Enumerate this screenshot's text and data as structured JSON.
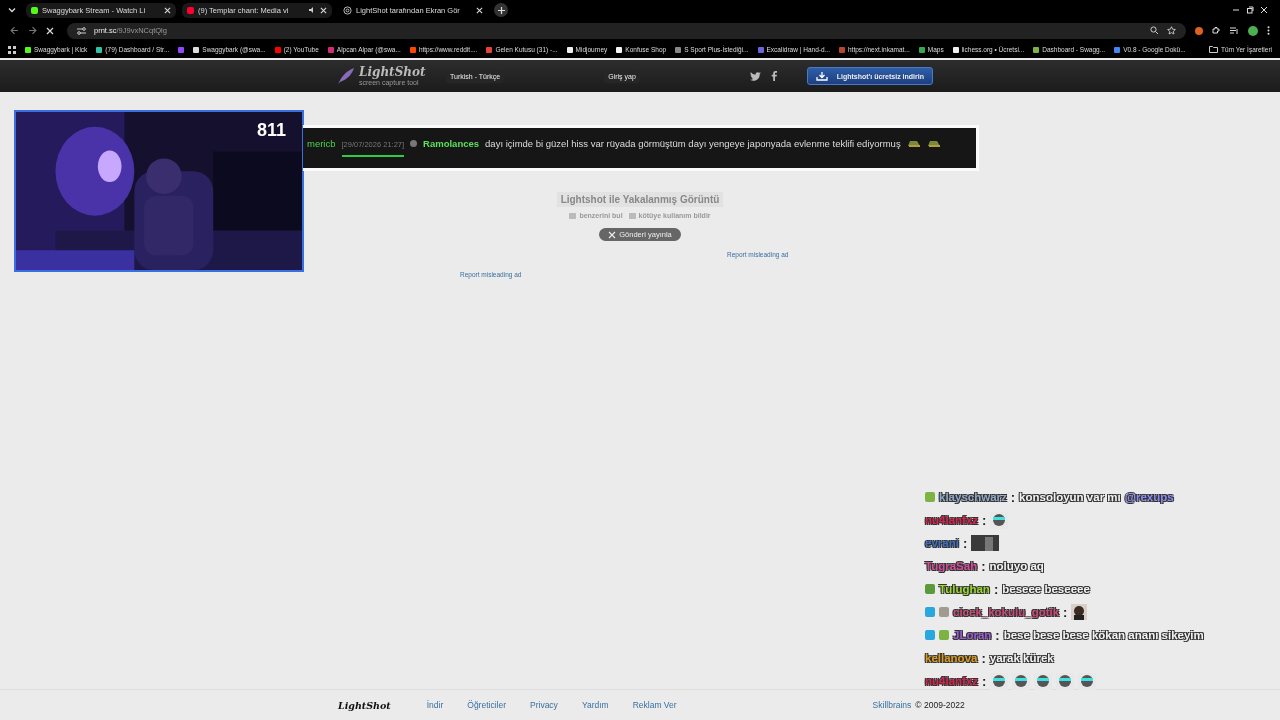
{
  "browser": {
    "tabs": [
      {
        "title": "Swaggybark Stream - Watch Li",
        "kind": "kick",
        "audio": false,
        "selected": false
      },
      {
        "title": "(9) Templar chant: Media vi",
        "kind": "youtube",
        "audio": true,
        "selected": false
      },
      {
        "title": "LightShot tarafından Ekran Gör",
        "kind": "lightshot",
        "audio": false,
        "selected": true
      }
    ],
    "address": {
      "host": "prnt.sc",
      "path": "/9J9vxNCqtQlg"
    },
    "bookmarks": [
      {
        "title": "Swaggybark | Kick",
        "color": "#53fc18"
      },
      {
        "title": "(79) Dashboard / Str...",
        "color": "#2ec4a6"
      },
      {
        "color": "#9146ff"
      },
      {
        "title": "Swaggybark (@swa...",
        "color": "#dddddd"
      },
      {
        "title": "(2) YouTube",
        "color": "#ff0000"
      },
      {
        "title": "Alpcan Alpar (@swa...",
        "color": "#d62976"
      },
      {
        "title": "https://www.reddit....",
        "color": "#ff4500"
      },
      {
        "title": "Gelen Kutusu (31) -...",
        "color": "#ea4335"
      },
      {
        "title": "Midjourney",
        "color": "#eeeeee"
      },
      {
        "title": "Konfuse Shop",
        "color": "#f5f5f5"
      },
      {
        "title": "S Sport Plus-İstediği...",
        "color": "#888888"
      },
      {
        "title": "Excalidraw | Hand-d...",
        "color": "#6965db"
      },
      {
        "title": "https://next.inkamat...",
        "color": "#b5462b"
      },
      {
        "title": "Maps",
        "color": "#34a853"
      },
      {
        "title": "lichess.org • Ücretsi...",
        "color": "#f0f0f0"
      },
      {
        "title": "Dashboard - Swagg...",
        "color": "#7cb342"
      },
      {
        "title": "V0.8 - Google Dokü...",
        "color": "#4285f4"
      }
    ],
    "all_bookmarks": "Tüm Yer İşaretleri"
  },
  "site_header": {
    "logo": "LightShot",
    "tagline": "screen capture tool",
    "language": "Turkish - Türkçe",
    "login": "Giriş yap",
    "download": "Lightshot'ı ücretsiz indirin"
  },
  "webcam": {
    "kind": "picture",
    "viewer_count": "811"
  },
  "highlight": {
    "user": "mericb",
    "timestamp": "[29/07/2026 21:27]",
    "author": "Ramolances",
    "message": "dayı içimde bi güzel hiss var rüyada görmüştüm dayı yengeye japonyada evlenme teklifi ediyormuş",
    "emotes": [
      {
        "kind": "car"
      },
      {
        "kind": "car"
      }
    ]
  },
  "content": {
    "title": "Lightshot ile Yakalanmış Görüntü",
    "actions": [
      "benzerini bul",
      "kötüye kullanım bildir"
    ],
    "share": "Gönderi yayınla",
    "ads": [
      "Report misleading ad",
      "Report misleading ad"
    ]
  },
  "chat": [
    {
      "user": "klayschwarz",
      "color": "#8fa8c8",
      "separator": ":",
      "badges": [
        {
          "kind": "paw"
        }
      ],
      "text": "konsoloyun var mı",
      "mention": "@rexups"
    },
    {
      "user": "nu4lanfxz",
      "color": "#d6244e",
      "separator": ":",
      "emotes": [
        {
          "kind": "face"
        }
      ]
    },
    {
      "user": "evrani",
      "color": "#3a6fc4",
      "separator": ":"
    },
    {
      "user": "TugraSah",
      "color": "#d0509a",
      "separator": ":",
      "text": "noluyo aq"
    },
    {
      "user": "Tulughan",
      "color": "#9ad82a",
      "separator": ":",
      "badges": [
        {
          "kind": "eye"
        }
      ],
      "text": "beseee beseeee"
    },
    {
      "user": "cicek_kokulu_gotik",
      "color": "#c84a78",
      "separator": ":",
      "badges": [
        {
          "kind": "cube"
        },
        {
          "kind": "stone"
        }
      ],
      "emotes": [
        {
          "kind": "portrait"
        }
      ]
    },
    {
      "user": "JLoran",
      "color": "#9c5ad8",
      "separator": ":",
      "badges": [
        {
          "kind": "cube"
        },
        {
          "kind": "paw"
        }
      ],
      "text": "bese bese bese kökan ananı sikeyim"
    },
    {
      "user": "kellanova",
      "color": "#d89a1e",
      "separator": ":",
      "text": "yarak kürek"
    },
    {
      "user": "nu4lanfxz",
      "color": "#d6244e",
      "separator": ":",
      "emotes": [
        {
          "kind": "face"
        },
        {
          "kind": "face"
        },
        {
          "kind": "face"
        },
        {
          "kind": "face"
        },
        {
          "kind": "face"
        }
      ]
    }
  ],
  "footer": {
    "logo": "LightShot",
    "links": [
      "İndir",
      "Öğreticiler",
      "Privacy",
      "Yardım",
      "Reklam Ver"
    ],
    "company": "Skillbrains",
    "copyright": "© 2009-2022"
  }
}
